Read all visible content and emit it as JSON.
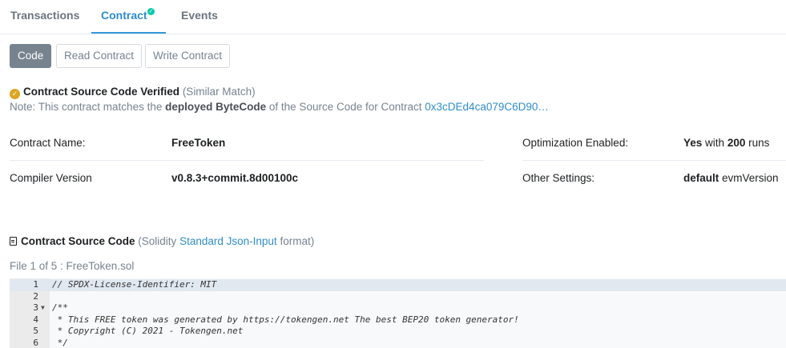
{
  "tabs": [
    {
      "label": "Transactions"
    },
    {
      "label": "Contract"
    },
    {
      "label": "Events"
    }
  ],
  "buttons": {
    "code": "Code",
    "read": "Read Contract",
    "write": "Write Contract"
  },
  "verified": {
    "title": "Contract Source Code Verified",
    "match": "(Similar Match)",
    "note_prefix": "Note: This contract matches the",
    "note_bold": "deployed ByteCode",
    "note_suffix": "of the Source Code for Contract",
    "note_link": "0x3cDEd4ca079C6D90…"
  },
  "info": {
    "contract_name_label": "Contract Name:",
    "contract_name_value": "FreeToken",
    "compiler_label": "Compiler Version",
    "compiler_value": "v0.8.3+commit.8d00100c",
    "optimization_label": "Optimization Enabled:",
    "optimization_yes": "Yes",
    "optimization_with": "with",
    "optimization_runs_count": "200",
    "optimization_runs": "runs",
    "other_label": "Other Settings:",
    "other_value_bold": "default",
    "other_value_rest": "evmVersion"
  },
  "source": {
    "title": "Contract Source Code",
    "paren_open": "(Solidity",
    "link": "Standard Json-Input",
    "paren_close": "format)",
    "file_label": "File 1 of 5 : FreeToken.sol"
  },
  "code_lines": [
    {
      "n": "1",
      "text": "// SPDX-License-Identifier: MIT"
    },
    {
      "n": "2",
      "text": ""
    },
    {
      "n": "3",
      "text": "/**"
    },
    {
      "n": "4",
      "text": " * This FREE token was generated by https://tokengen.net The best BEP20 token generator!"
    },
    {
      "n": "5",
      "text": " * Copyright (C) 2021 - Tokengen.net"
    },
    {
      "n": "6",
      "text": " */"
    }
  ],
  "colors": {
    "accent": "#3498db",
    "verified_badge": "#dba620",
    "tab_check": "#00c9a7",
    "active_button": "#77838f"
  }
}
